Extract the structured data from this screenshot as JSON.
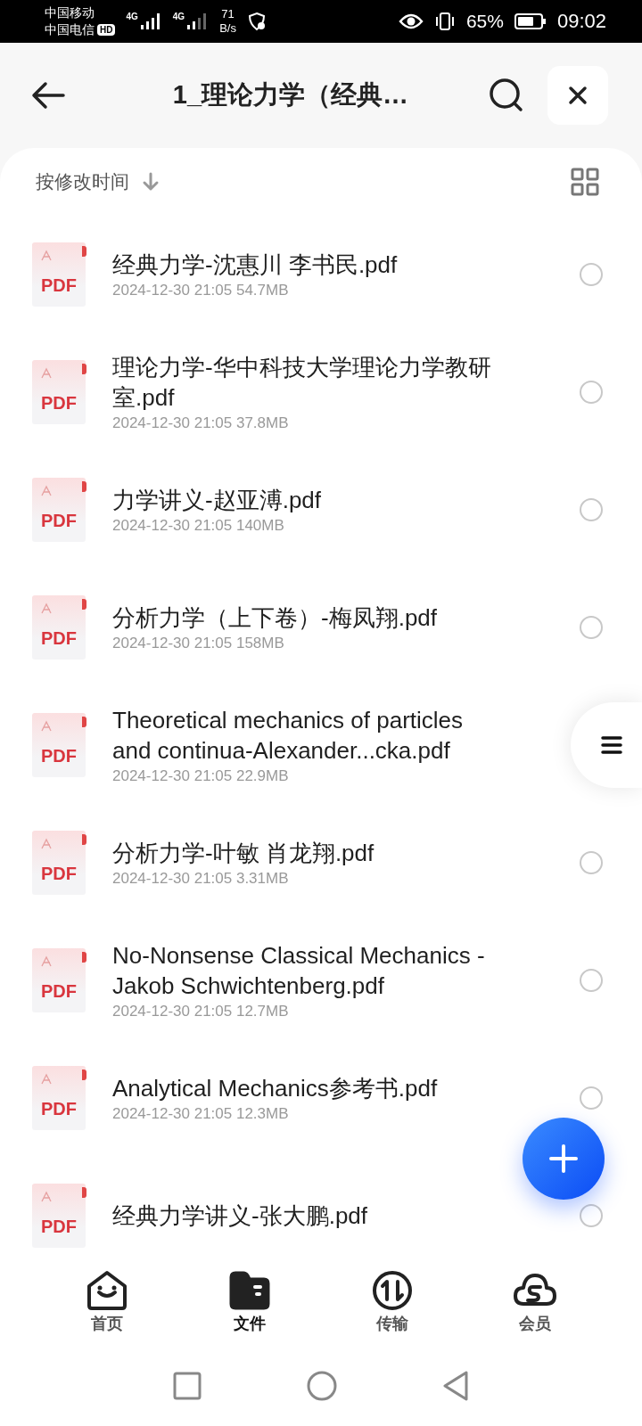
{
  "status_bar": {
    "carrier_1": "中国移动",
    "carrier_2": "中国电信",
    "hd": "HD",
    "net_1": "4G",
    "net_2": "4G",
    "speed": "71",
    "speed_unit": "B/s",
    "battery": "65%",
    "time": "09:02"
  },
  "header": {
    "title": "1_理论力学（经典…"
  },
  "sort": {
    "label": "按修改时间"
  },
  "files": [
    {
      "badge": "PDF",
      "name": "经典力学-沈惠川 李书民.pdf",
      "meta": "2024-12-30 21:05  54.7MB",
      "selected": false
    },
    {
      "badge": "PDF",
      "name": "理论力学-华中科技大学理论力学教研室.pdf",
      "meta": "2024-12-30 21:05  37.8MB",
      "selected": false
    },
    {
      "badge": "PDF",
      "name": "力学讲义-赵亚溥.pdf",
      "meta": "2024-12-30 21:05  140MB",
      "selected": false
    },
    {
      "badge": "PDF",
      "name": "分析力学（上下卷）-梅凤翔.pdf",
      "meta": "2024-12-30 21:05  158MB",
      "selected": false
    },
    {
      "badge": "PDF",
      "name": "Theoretical mechanics of particles and continua-Alexander...cka.pdf",
      "meta": "2024-12-30 21:05  22.9MB"
    },
    {
      "badge": "PDF",
      "name": "分析力学-叶敏 肖龙翔.pdf",
      "meta": "2024-12-30 21:05  3.31MB",
      "selected": false
    },
    {
      "badge": "PDF",
      "name": "No-Nonsense Classical Mechanics -Jakob Schwichtenberg.pdf",
      "meta": "2024-12-30 21:05  12.7MB",
      "selected": false
    },
    {
      "badge": "PDF",
      "name": "Analytical Mechanics参考书.pdf",
      "meta": "2024-12-30 21:05  12.3MB",
      "selected": false
    },
    {
      "badge": "PDF",
      "name": "经典力学讲义-张大鹏.pdf",
      "selected": false
    }
  ],
  "tabs": [
    {
      "kind": "home",
      "label": "首页",
      "selected": false
    },
    {
      "kind": "files",
      "label": "文件",
      "selected": true
    },
    {
      "kind": "transfer",
      "label": "传输",
      "selected": false
    },
    {
      "kind": "vip",
      "label": "会员",
      "selected": false
    }
  ]
}
